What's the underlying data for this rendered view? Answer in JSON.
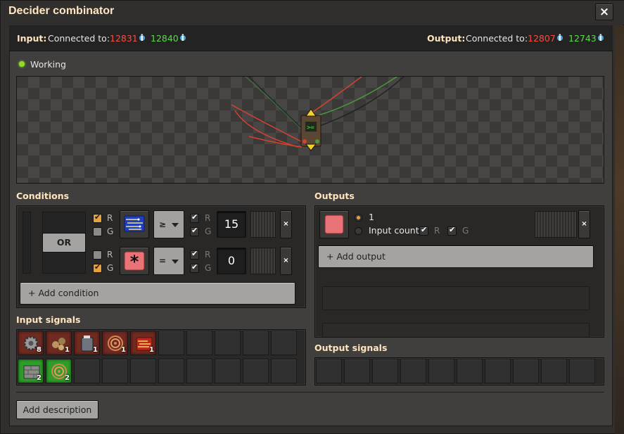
{
  "window": {
    "title": "Decider combinator",
    "close_icon": "×"
  },
  "connections": {
    "input_label": "Input:",
    "input_connected": "Connected to:",
    "input_red": "12831",
    "input_green": "12840",
    "output_label": "Output:",
    "output_connected": "Connected to:",
    "output_red": "12807",
    "output_green": "12743",
    "info_glyph": "i"
  },
  "status": {
    "text": "Working",
    "color": "#8fdd2a"
  },
  "conditions": {
    "label": "Conditions",
    "or_label": "OR",
    "rows": [
      {
        "red_checked": true,
        "green_checked": false,
        "signal_icon": "advanced-circuit-icon",
        "operator": "≥",
        "red_input": true,
        "green_input": true,
        "value": "15",
        "r": "R",
        "g": "G"
      },
      {
        "red_checked": false,
        "green_checked": true,
        "signal_icon": "signal-each-icon",
        "operator": "=",
        "red_input": true,
        "green_input": true,
        "value": "0",
        "r": "R",
        "g": "G"
      }
    ],
    "add_label": "+ Add condition",
    "remove_glyph": "×"
  },
  "outputs": {
    "label": "Outputs",
    "row": {
      "signal_icon": "red-signal-icon",
      "constant_label": "1",
      "input_count_label": "Input count",
      "r": "R",
      "g": "G"
    },
    "add_label": "+ Add output",
    "remove_glyph": "×"
  },
  "input_signals": {
    "label": "Input signals",
    "items": [
      {
        "icon": "gear-icon",
        "count": "8",
        "bg": "red"
      },
      {
        "icon": "iron-ore-icon",
        "count": "1",
        "bg": "red"
      },
      {
        "icon": "battery-icon",
        "count": "1",
        "bg": "red"
      },
      {
        "icon": "copper-cable-icon",
        "count": "1",
        "bg": "red"
      },
      {
        "icon": "advanced-circuit-icon",
        "count": "1",
        "bg": "red"
      },
      {
        "icon": "stone-brick-icon",
        "count": "2",
        "bg": "green"
      },
      {
        "icon": "copper-cable-icon",
        "count": "2",
        "bg": "green"
      }
    ]
  },
  "output_signals": {
    "label": "Output signals"
  },
  "description": {
    "add_label": "Add description"
  },
  "colors": {
    "red_wire": "#ff4c3f",
    "green_wire": "#5bdb4a",
    "accent": "#ffe6c0",
    "checkbox_on": "#e8a03a"
  }
}
